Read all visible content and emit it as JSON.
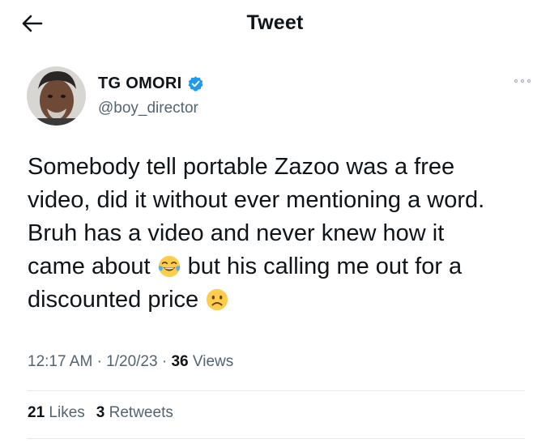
{
  "header": {
    "title": "Tweet",
    "back_icon": "arrow-left-icon"
  },
  "author": {
    "display_name": "TG OMORI",
    "handle": "@boy_director",
    "verified_icon": "verified-badge-icon",
    "verified_color": "#1d9bf0"
  },
  "tweet": {
    "line1": "Somebody tell portable Zazoo was a free",
    "line2": "video, did it without ever mentioning a word.",
    "line3": "Bruh has a video and never knew how it",
    "line4_a": "came about",
    "line4_b": "but his calling me out for a",
    "line5": "discounted price",
    "emoji_1": "face-with-tears-of-joy-icon",
    "emoji_2": "frowning-face-icon"
  },
  "meta": {
    "time": "12:17 AM",
    "separator": "·",
    "date": "1/20/23",
    "views_count": "36",
    "views_label": "Views"
  },
  "stats": {
    "likes_count": "21",
    "likes_label": "Likes",
    "retweets_count": "3",
    "retweets_label": "Retweets"
  },
  "more_icon": "more-horizontal-icon"
}
